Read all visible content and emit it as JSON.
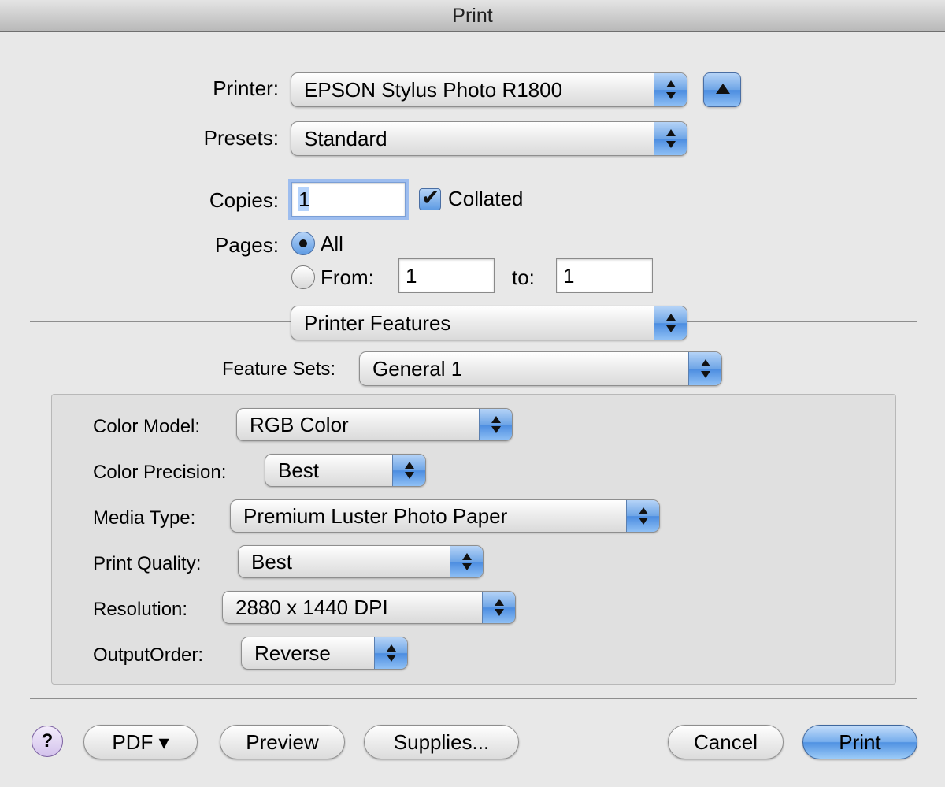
{
  "window": {
    "title": "Print"
  },
  "printer": {
    "label": "Printer:",
    "value": "EPSON Stylus Photo R1800"
  },
  "presets": {
    "label": "Presets:",
    "value": "Standard"
  },
  "copies": {
    "label": "Copies:",
    "value": "1",
    "collated_label": "Collated",
    "collated": true
  },
  "pages": {
    "label": "Pages:",
    "all_label": "All",
    "from_label": "From:",
    "from_value": "1",
    "to_label": "to:",
    "to_value": "1",
    "selected": "All"
  },
  "section": {
    "value": "Printer Features"
  },
  "feature_sets": {
    "label": "Feature Sets:",
    "value": "General 1"
  },
  "features": {
    "color_model": {
      "label": "Color Model:",
      "value": "RGB Color"
    },
    "color_precision": {
      "label": "Color Precision:",
      "value": "Best"
    },
    "media_type": {
      "label": "Media Type:",
      "value": "Premium Luster Photo Paper"
    },
    "print_quality": {
      "label": "Print Quality:",
      "value": "Best"
    },
    "resolution": {
      "label": "Resolution:",
      "value": "2880 x 1440 DPI"
    },
    "output_order": {
      "label": "OutputOrder:",
      "value": "Reverse"
    }
  },
  "buttons": {
    "help": "?",
    "pdf": "PDF ▾",
    "preview": "Preview",
    "supplies": "Supplies...",
    "cancel": "Cancel",
    "print": "Print"
  },
  "colors": {
    "accent": "#5e9be3",
    "background": "#e8e8e8"
  },
  "icons": {
    "disclosure": "triangle-up-icon",
    "popup_arrows": "up-down-chevron-icon",
    "help": "question-mark-icon"
  }
}
